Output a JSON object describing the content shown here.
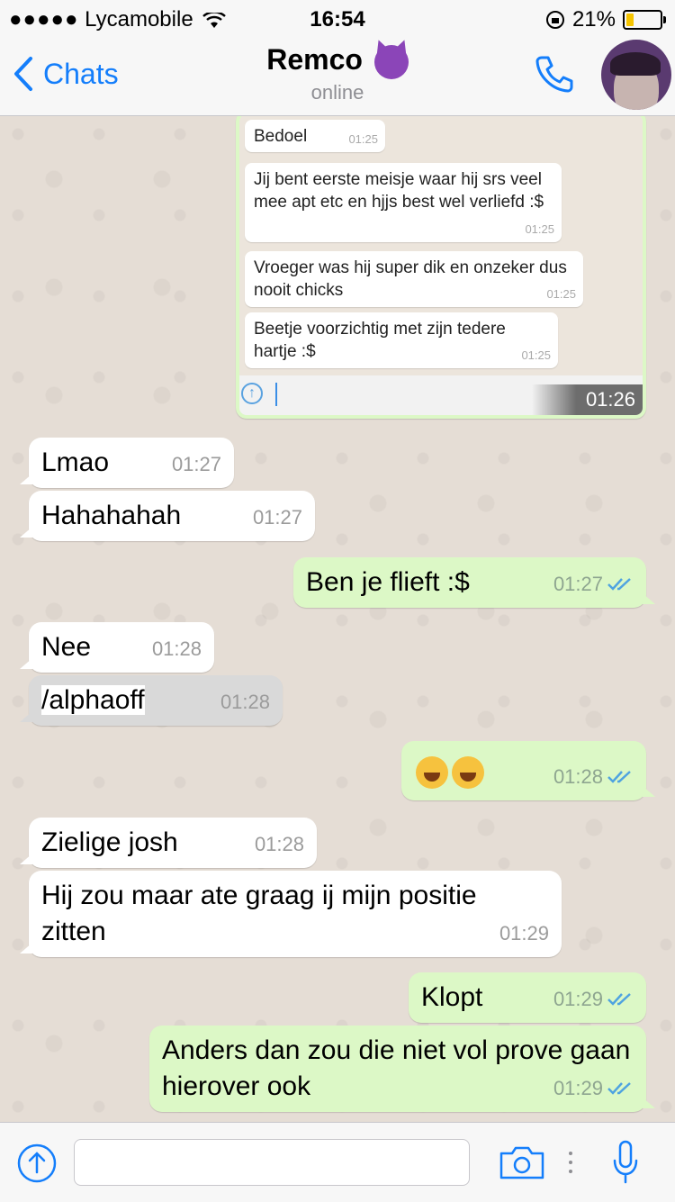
{
  "status": {
    "carrier": "Lycamobile",
    "time": "16:54",
    "battery": "21%"
  },
  "header": {
    "back_label": "Chats",
    "contact_name": "Remco",
    "contact_status": "online"
  },
  "embedded_screenshot": {
    "messages": [
      {
        "text": "Bedoel",
        "time": "01:25"
      },
      {
        "text": "Jij bent eerste meisje waar hij srs veel mee apt etc en hjjs best wel verliefd :$",
        "time": "01:25"
      },
      {
        "text": "Vroeger was hij super dik en onzeker dus nooit chicks",
        "time": "01:25"
      },
      {
        "text": "Beetje voorzichtig met zijn tedere hartje :$",
        "time": "01:25"
      }
    ],
    "time": "01:26"
  },
  "messages": [
    {
      "text": "Lmao",
      "time": "01:27"
    },
    {
      "text": "Hahahahah",
      "time": "01:27"
    },
    {
      "text": "Ben je flieft :$",
      "time": "01:27"
    },
    {
      "text": "Nee",
      "time": "01:28"
    },
    {
      "text": "/alphaoff",
      "time": "01:28"
    },
    {
      "text": "",
      "time": "01:28"
    },
    {
      "text": "Zielige josh",
      "time": "01:28"
    },
    {
      "text": "Hij zou maar ate graag  ij mijn positie zitten",
      "time": "01:29"
    },
    {
      "text": "Klopt",
      "time": "01:29"
    },
    {
      "text": "Anders dan zou die niet vol prove gaan hierover ook",
      "time": "01:29"
    }
  ],
  "icons": {
    "back": "chevron-left-icon",
    "call": "phone-icon",
    "upload": "upload-icon",
    "camera": "camera-icon",
    "more": "more-dots-icon",
    "mic": "microphone-icon",
    "read": "double-check-icon"
  },
  "colors": {
    "accent": "#147efb",
    "outgoing": "#dcf8c6",
    "incoming": "#ffffff",
    "read_ticks": "#4fa3e0"
  }
}
